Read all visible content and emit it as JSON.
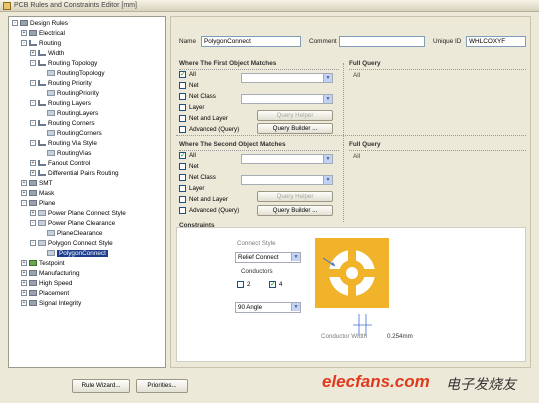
{
  "window": {
    "title": "PCB Rules and Constraints Editor [mm]"
  },
  "tree": [
    {
      "label": "Design Rules",
      "level": 0,
      "exp": "-",
      "icon": "folder"
    },
    {
      "label": "Electrical",
      "level": 1,
      "exp": "+",
      "icon": "folder"
    },
    {
      "label": "Routing",
      "level": 1,
      "exp": "-",
      "icon": "route"
    },
    {
      "label": "Width",
      "level": 2,
      "exp": "+",
      "icon": "route"
    },
    {
      "label": "Routing Topology",
      "level": 2,
      "exp": "-",
      "icon": "route"
    },
    {
      "label": "RoutingTopology",
      "level": 3,
      "exp": "",
      "icon": "rule"
    },
    {
      "label": "Routing Priority",
      "level": 2,
      "exp": "-",
      "icon": "route"
    },
    {
      "label": "RoutingPriority",
      "level": 3,
      "exp": "",
      "icon": "rule"
    },
    {
      "label": "Routing Layers",
      "level": 2,
      "exp": "-",
      "icon": "route"
    },
    {
      "label": "RoutingLayers",
      "level": 3,
      "exp": "",
      "icon": "rule"
    },
    {
      "label": "Routing Corners",
      "level": 2,
      "exp": "-",
      "icon": "route"
    },
    {
      "label": "RoutingCorners",
      "level": 3,
      "exp": "",
      "icon": "rule"
    },
    {
      "label": "Routing Via Style",
      "level": 2,
      "exp": "-",
      "icon": "route"
    },
    {
      "label": "RoutingVias",
      "level": 3,
      "exp": "",
      "icon": "rule"
    },
    {
      "label": "Fanout Control",
      "level": 2,
      "exp": "+",
      "icon": "route"
    },
    {
      "label": "Differential Pairs Routing",
      "level": 2,
      "exp": "+",
      "icon": "route"
    },
    {
      "label": "SMT",
      "level": 1,
      "exp": "+",
      "icon": "folder"
    },
    {
      "label": "Mask",
      "level": 1,
      "exp": "+",
      "icon": "folder"
    },
    {
      "label": "Plane",
      "level": 1,
      "exp": "-",
      "icon": "folder"
    },
    {
      "label": "Power Plane Connect Style",
      "level": 2,
      "exp": "+",
      "icon": "rule"
    },
    {
      "label": "Power Plane Clearance",
      "level": 2,
      "exp": "-",
      "icon": "rule"
    },
    {
      "label": "PlaneClearance",
      "level": 3,
      "exp": "",
      "icon": "rule"
    },
    {
      "label": "Polygon Connect Style",
      "level": 2,
      "exp": "-",
      "icon": "rule"
    },
    {
      "label": "PolygonConnect",
      "level": 3,
      "exp": "",
      "icon": "rule",
      "selected": true
    },
    {
      "label": "Testpoint",
      "level": 1,
      "exp": "+",
      "icon": "green"
    },
    {
      "label": "Manufacturing",
      "level": 1,
      "exp": "+",
      "icon": "folder"
    },
    {
      "label": "High Speed",
      "level": 1,
      "exp": "+",
      "icon": "folder"
    },
    {
      "label": "Placement",
      "level": 1,
      "exp": "+",
      "icon": "folder"
    },
    {
      "label": "Signal Integrity",
      "level": 1,
      "exp": "+",
      "icon": "folder"
    }
  ],
  "rule": {
    "name_label": "Name",
    "name_value": "PolygonConnect",
    "comment_label": "Comment",
    "comment_value": "",
    "uid_label": "Unique ID",
    "uid_value": "WHLCOXYF"
  },
  "first": {
    "title": "Where The First Object Matches",
    "query_title": "Full Query",
    "query": "All",
    "options": [
      "All",
      "Net",
      "Net Class",
      "Layer",
      "Net and Layer",
      "Advanced (Query)"
    ],
    "checked": [
      true,
      false,
      false,
      false,
      false,
      false
    ],
    "helper_label": "Query Helper",
    "builder_label": "Query Builder ..."
  },
  "second": {
    "title": "Where The Second Object Matches",
    "query_title": "Full Query",
    "query": "All",
    "options": [
      "All",
      "Net",
      "Net Class",
      "Layer",
      "Net and Layer",
      "Advanced (Query)"
    ],
    "checked": [
      true,
      false,
      false,
      false,
      false,
      false
    ],
    "helper_label": "Query Helper",
    "builder_label": "Query Builder ..."
  },
  "constraints": {
    "title": "Constraints",
    "connect_style_label": "Connect Style",
    "connect_style_value": "Relief Connect",
    "conductors_label": "Conductors",
    "conductor_2": "2",
    "conductor_4": "4",
    "conductor_2_checked": false,
    "conductor_4_checked": true,
    "angle_value": "90 Angle",
    "conductor_width_label": "Conductor Width",
    "conductor_width_value": "0.254mm"
  },
  "buttons": {
    "rule_wizard": "Rule Wizard...",
    "priorities": "Priorities..."
  },
  "watermark": {
    "text": "elecfans.com",
    "cn": "电子发烧友"
  },
  "colors": {
    "pad": "#f0b32a",
    "selected": "#1c3e8c",
    "accent_blue": "#3f6fd6",
    "watermark": "#e03a1e"
  }
}
